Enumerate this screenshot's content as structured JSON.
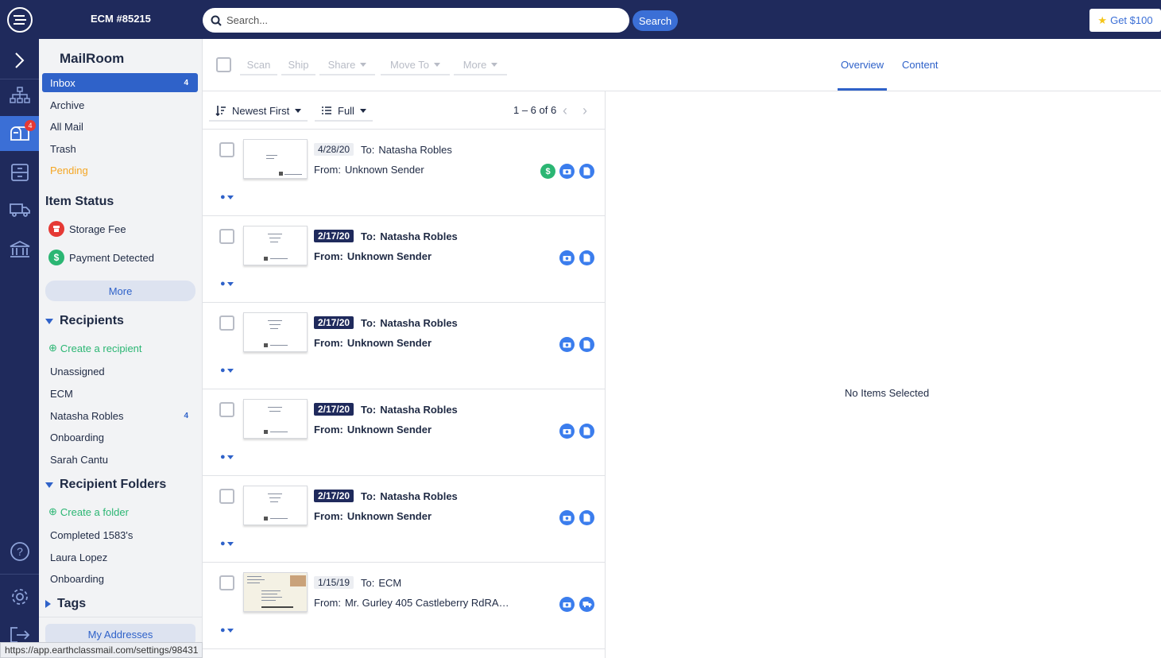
{
  "header": {
    "account": "ECM #85215",
    "search_placeholder": "Search...",
    "search_button": "Search",
    "promo_button": "Get $100"
  },
  "rail": {
    "mail_badge": "4"
  },
  "sidebar": {
    "title": "MailRoom",
    "folders": [
      {
        "label": "Inbox",
        "count": "4"
      },
      {
        "label": "Archive"
      },
      {
        "label": "All Mail"
      },
      {
        "label": "Trash"
      },
      {
        "label": "Pending"
      }
    ],
    "item_status_title": "Item Status",
    "statuses": [
      {
        "label": "Storage Fee"
      },
      {
        "label": "Payment Detected"
      }
    ],
    "more_label": "More",
    "recipients_title": "Recipients",
    "create_recipient": "Create a recipient",
    "recipients": [
      {
        "label": "Unassigned"
      },
      {
        "label": "ECM"
      },
      {
        "label": "Natasha Robles",
        "count": "4"
      },
      {
        "label": "Onboarding"
      },
      {
        "label": "Sarah Cantu"
      }
    ],
    "recipient_folders_title": "Recipient Folders",
    "create_folder": "Create a folder",
    "recipient_folders": [
      {
        "label": "Completed 1583's"
      },
      {
        "label": "Laura Lopez"
      },
      {
        "label": "Onboarding"
      }
    ],
    "tags_title": "Tags",
    "my_addresses": "My Addresses"
  },
  "toolbar": {
    "scan": "Scan",
    "ship": "Ship",
    "share": "Share",
    "move_to": "Move To",
    "more": "More",
    "tab_overview": "Overview",
    "tab_content": "Content"
  },
  "list": {
    "sort_label": "Newest First",
    "view_label": "Full",
    "pager": "1 – 6 of 6",
    "to_label": "To:",
    "from_label": "From:",
    "items": [
      {
        "date": "4/28/20",
        "to": "Natasha Robles",
        "from": "Unknown Sender",
        "unread": false
      },
      {
        "date": "2/17/20",
        "to": "Natasha Robles",
        "from": "Unknown Sender",
        "unread": true
      },
      {
        "date": "2/17/20",
        "to": "Natasha Robles",
        "from": "Unknown Sender",
        "unread": true
      },
      {
        "date": "2/17/20",
        "to": "Natasha Robles",
        "from": "Unknown Sender",
        "unread": true
      },
      {
        "date": "2/17/20",
        "to": "Natasha Robles",
        "from": "Unknown Sender",
        "unread": true
      },
      {
        "date": "1/15/19",
        "to": "ECM",
        "from": "Mr. Gurley 405 Castleberry RdRA…",
        "unread": false
      }
    ]
  },
  "detail": {
    "empty_text": "No Items Selected"
  },
  "statusbar": {
    "url": "https://app.earthclassmail.com/settings/98431"
  },
  "colors": {
    "navy": "#1f2a5c",
    "accent": "#2f62c9",
    "green": "#2bb673",
    "pending": "#f5a623"
  }
}
